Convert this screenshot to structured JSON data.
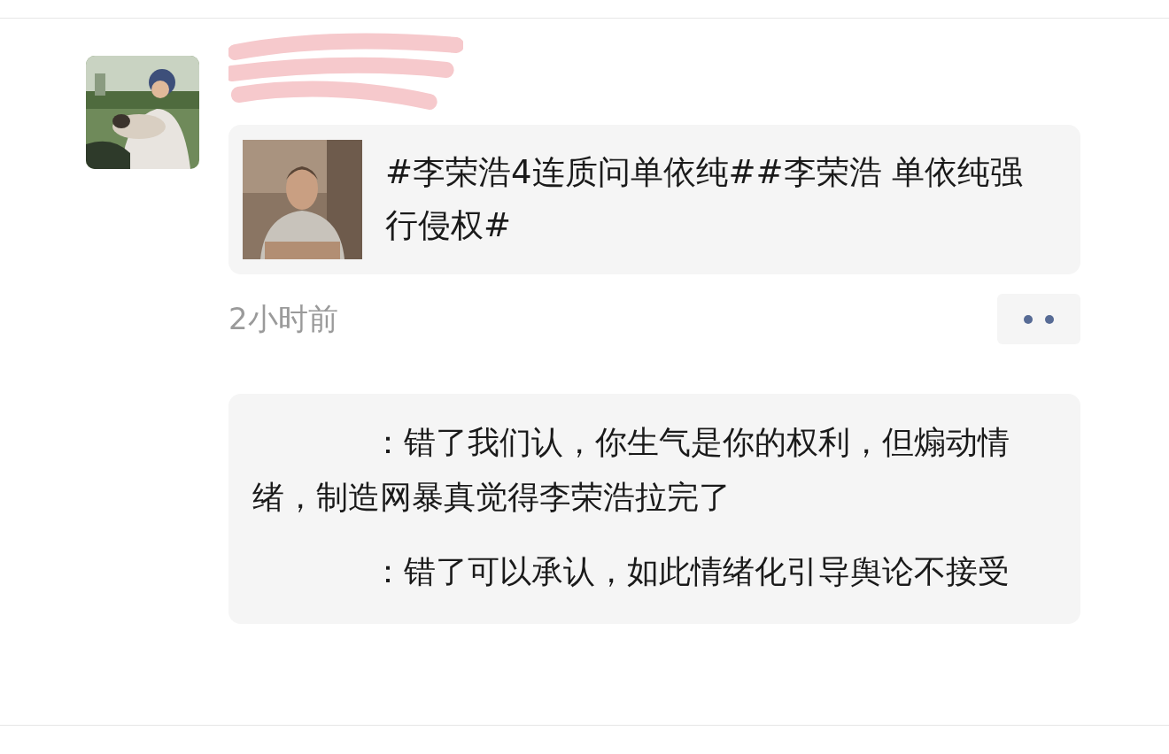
{
  "post": {
    "link_card": {
      "text": "#李荣浩4连质问单依纯##李荣浩 单依纯强行侵权#"
    },
    "time": "2小时前",
    "comments": [
      {
        "text": "：错了我们认，你生气是你的权利，但煽动情绪，制造网暴真觉得李荣浩拉完了"
      },
      {
        "text": "：错了可以承认，如此情绪化引导舆论不接受"
      }
    ]
  }
}
